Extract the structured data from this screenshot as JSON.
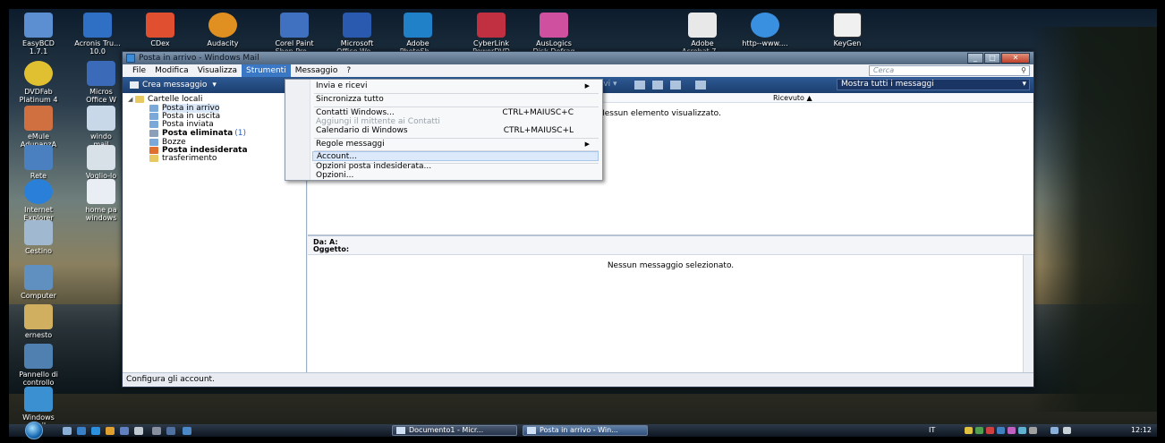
{
  "desktop": {
    "icons_top_row": [
      {
        "label": "EasyBCD\n1.7.1"
      },
      {
        "label": "Acronis Tru...\n10.0"
      },
      {
        "label": "CDex"
      },
      {
        "label": "Audacity"
      },
      {
        "label": "Corel Paint\nShop Pro..."
      },
      {
        "label": "Microsoft\nOffice Wo..."
      },
      {
        "label": "Adobe\nPhotoSh..."
      },
      {
        "label": "CyberLink\nPowerDVD"
      },
      {
        "label": "AusLogics\nDisk Defrag"
      },
      {
        "label": "Adobe\nAcrobat 7..."
      },
      {
        "label": "http--www...."
      },
      {
        "label": "KeyGen"
      }
    ],
    "icons_left_col": [
      {
        "label": "DVDFab\nPlatinum 4"
      },
      {
        "label": "eMule\nAdunanzA"
      },
      {
        "label": "Rete"
      },
      {
        "label": "Internet\nExplorer"
      },
      {
        "label": "Cestino"
      },
      {
        "label": "Computer"
      },
      {
        "label": "ernesto"
      },
      {
        "label": "Pannello di\ncontrollo"
      },
      {
        "label": "Windows\nMail"
      }
    ],
    "icons_second_col": [
      {
        "label": "Micros\nOffice W"
      },
      {
        "label": "windo\nmail"
      },
      {
        "label": "Voglio-lo"
      },
      {
        "label": "home pa\nwindows"
      }
    ]
  },
  "window": {
    "title": "Posta in arrivo - Windows Mail",
    "menu": [
      "File",
      "Modifica",
      "Visualizza",
      "Strumenti",
      "Messaggio",
      "?"
    ],
    "active_menu": "Strumenti",
    "search_placeholder": "Cerca",
    "toolbar": {
      "new_message": "Crea messaggio",
      "ricevi": "Ricevi",
      "view_filter": "Mostra tutti i messaggi"
    },
    "folders": {
      "root": "Cartelle locali",
      "items": [
        {
          "label": "Posta in arrivo",
          "bold": false,
          "count": ""
        },
        {
          "label": "Posta in uscita",
          "bold": false,
          "count": ""
        },
        {
          "label": "Posta inviata",
          "bold": false,
          "count": ""
        },
        {
          "label": "Posta eliminata",
          "bold": true,
          "count": "(1)"
        },
        {
          "label": "Bozze",
          "bold": false,
          "count": ""
        },
        {
          "label": "Posta indesiderata",
          "bold": true,
          "count": ""
        },
        {
          "label": "trasferimento",
          "bold": false,
          "count": ""
        }
      ]
    },
    "message_list": {
      "column_received": "Ricevuto",
      "empty_text": "Nessun elemento visualizzato."
    },
    "preview": {
      "from_to": "Da:   A:",
      "subject": "Oggetto:",
      "empty_text": "Nessun messaggio selezionato."
    },
    "status": "Configura gli account."
  },
  "tools_menu": {
    "items": [
      {
        "label": "Invia e ricevi",
        "shortcut": "",
        "submenu": true,
        "disabled": false,
        "hover": false
      },
      {
        "label": "Sincronizza tutto",
        "shortcut": "",
        "submenu": false,
        "disabled": false,
        "hover": false
      },
      {
        "label": "Contatti Windows...",
        "shortcut": "CTRL+MAIUSC+C",
        "submenu": false,
        "disabled": false,
        "hover": false
      },
      {
        "label": "Aggiungi il mittente ai Contatti",
        "shortcut": "",
        "submenu": false,
        "disabled": true,
        "hover": false
      },
      {
        "label": "Calendario di Windows",
        "shortcut": "CTRL+MAIUSC+L",
        "submenu": false,
        "disabled": false,
        "hover": false
      },
      {
        "label": "Regole messaggi",
        "shortcut": "",
        "submenu": true,
        "disabled": false,
        "hover": false
      },
      {
        "label": "Account...",
        "shortcut": "",
        "submenu": false,
        "disabled": false,
        "hover": true
      },
      {
        "label": "Opzioni posta indesiderata...",
        "shortcut": "",
        "submenu": false,
        "disabled": false,
        "hover": false
      },
      {
        "label": "Opzioni...",
        "shortcut": "",
        "submenu": false,
        "disabled": false,
        "hover": false
      }
    ]
  },
  "taskbar": {
    "buttons": [
      "Documento1 - Micr...",
      "Posta in arrivo - Win..."
    ],
    "clock": "12:12",
    "lang": "IT"
  }
}
